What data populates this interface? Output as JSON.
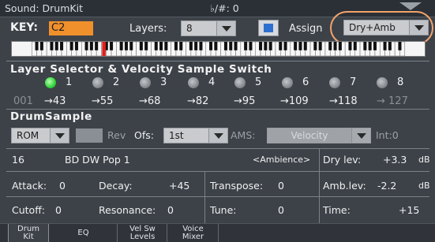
{
  "title_bar": {
    "sound_label": "Sound: DrumKit",
    "flat_sharp": "♭/#: 0"
  },
  "key_row": {
    "key_label": "KEY:",
    "key_value": "C2",
    "layers_label": "Layers:",
    "layers_value": "8",
    "assign_label": "Assign",
    "assign_value": "Dry+Amb"
  },
  "layer_selector": {
    "title": "Layer Selector & Velocity Sample Switch",
    "layers": [
      "1",
      "2",
      "3",
      "4",
      "5",
      "6",
      "7",
      "8"
    ],
    "active_layer": "1",
    "velocities": [
      "001",
      "→43",
      "→55",
      "→68",
      "→82",
      "→95",
      "→109",
      "→118",
      "→ 127"
    ]
  },
  "drum_sample": {
    "title": "DrumSample",
    "source_value": "ROM",
    "rev_label": "Rev",
    "ofs_label": "Ofs:",
    "ofs_value": "1st",
    "ams_label": "AMS:",
    "ams_value": "Velocity",
    "int_label": "Int:0",
    "sample_number": "16",
    "sample_name": "BD DW Pop 1",
    "ambience_tag": "<Ambience>",
    "dry_lev_label": "Dry lev:",
    "dry_lev_value": "+3.3",
    "db1": "dB",
    "attack_label": "Attack:",
    "attack_value": "0",
    "decay_label": "Decay:",
    "decay_value": "+45",
    "transpose_label": "Transpose:",
    "transpose_value": "0",
    "amb_lev_label": "Amb.lev:",
    "amb_lev_value": "-2.2",
    "db2": "dB",
    "cutoff_label": "Cutoff:",
    "cutoff_value": "0",
    "resonance_label": "Resonance:",
    "resonance_value": "0",
    "tune_label": "Tune:",
    "tune_value": "0",
    "time_label": "Time:",
    "time_value": "+15"
  },
  "bottom_tabs": [
    {
      "line1": "Drum",
      "line2": "Kit"
    },
    {
      "line1": "EQ",
      "line2": ""
    },
    {
      "line1": "Vel Sw",
      "line2": "Levels"
    },
    {
      "line1": "Voice",
      "line2": "Mixer"
    }
  ],
  "colors": {
    "background": "#3d4249",
    "key_field": "#f0902c",
    "active_led": "#2fd33a",
    "assign_highlight": "#f3a36a",
    "keyboard_marker": "#e0201c"
  }
}
